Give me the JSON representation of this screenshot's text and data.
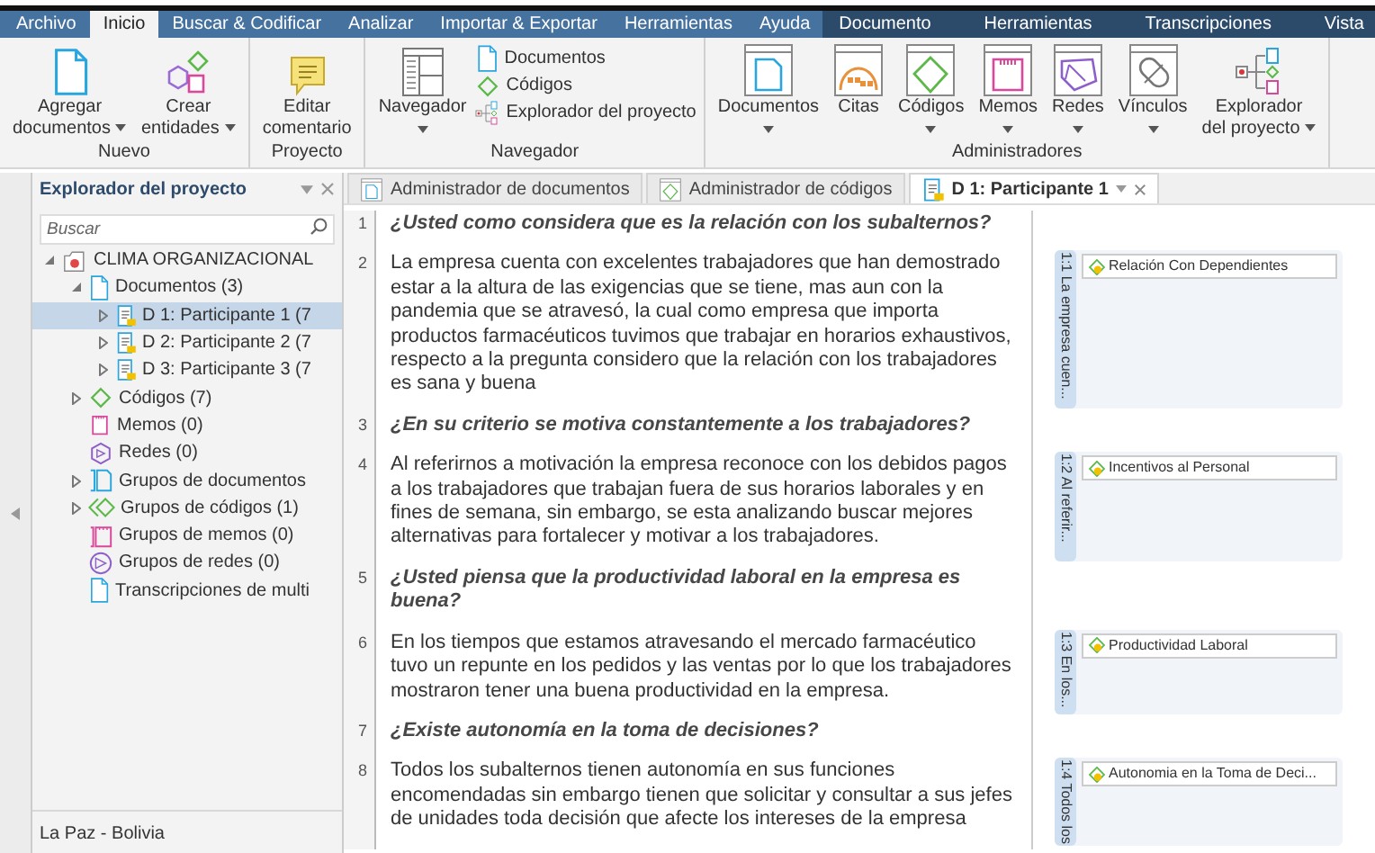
{
  "menu_tabs": [
    {
      "label": "Archivo",
      "selected": false,
      "kind": "main"
    },
    {
      "label": "Inicio",
      "selected": true,
      "kind": "main"
    },
    {
      "label": "Buscar & Codificar",
      "selected": false,
      "kind": "main"
    },
    {
      "label": "Analizar",
      "selected": false,
      "kind": "main"
    },
    {
      "label": "Importar & Exportar",
      "selected": false,
      "kind": "main"
    },
    {
      "label": "Herramientas",
      "selected": false,
      "kind": "main"
    },
    {
      "label": "Ayuda",
      "selected": false,
      "kind": "main"
    },
    {
      "label": "Documento",
      "selected": false,
      "kind": "contextual"
    },
    {
      "label": "Herramientas",
      "selected": false,
      "kind": "contextual"
    },
    {
      "label": "Transcripciones",
      "selected": false,
      "kind": "contextual"
    },
    {
      "label": "Vista",
      "selected": false,
      "kind": "contextual"
    }
  ],
  "ribbon": {
    "groups": [
      {
        "label": "Nuevo",
        "items": [
          {
            "kind": "large",
            "label": "Agregar\ndocumentos",
            "dropdown": true
          },
          {
            "kind": "large",
            "label": "Crear\nentidades",
            "dropdown": true
          }
        ]
      },
      {
        "label": "Proyecto",
        "items": [
          {
            "kind": "large",
            "label": "Editar\ncomentario",
            "dropdown": false
          }
        ]
      },
      {
        "label": "Navegador",
        "items": [
          {
            "kind": "tall",
            "label": "Navegador",
            "dropdown": true
          },
          {
            "kind": "small",
            "label": "Documentos"
          },
          {
            "kind": "small",
            "label": "Códigos"
          },
          {
            "kind": "small",
            "label": "Explorador del proyecto"
          }
        ]
      },
      {
        "label": "Administradores",
        "items": [
          {
            "kind": "tall",
            "label": "Documentos",
            "dropdown": true
          },
          {
            "kind": "tall",
            "label": "Citas",
            "dropdown": false
          },
          {
            "kind": "tall",
            "label": "Códigos",
            "dropdown": true
          },
          {
            "kind": "tall",
            "label": "Memos",
            "dropdown": true
          },
          {
            "kind": "tall",
            "label": "Redes",
            "dropdown": true
          },
          {
            "kind": "tall",
            "label": "Vínculos",
            "dropdown": true
          },
          {
            "kind": "large",
            "label": "Explorador\ndel proyecto",
            "dropdown": true
          }
        ]
      }
    ]
  },
  "explorer": {
    "title": "Explorador del proyecto",
    "search": {
      "placeholder": "Buscar"
    },
    "tree": [
      {
        "label": "CLIMA ORGANIZACIONAL",
        "kind": "project",
        "expanded": true,
        "selected": false,
        "children": [
          {
            "label": "Documentos (3)",
            "kind": "folder",
            "expanded": true,
            "selected": false,
            "children": [
              {
                "label": "D 1: Participante 1 (7",
                "kind": "document",
                "expanded": false,
                "selected": true
              },
              {
                "label": "D 2: Participante 2 (7",
                "kind": "document",
                "expanded": false,
                "selected": false
              },
              {
                "label": "D 3: Participante 3 (7",
                "kind": "document",
                "expanded": false,
                "selected": false
              }
            ]
          },
          {
            "label": "Códigos (7)",
            "kind": "codes",
            "expanded": false,
            "selected": false
          },
          {
            "label": "Memos (0)",
            "kind": "memos",
            "selected": false
          },
          {
            "label": "Redes (0)",
            "kind": "networks",
            "selected": false
          },
          {
            "label": "Grupos de documentos",
            "kind": "docgroups",
            "expanded": false,
            "selected": false
          },
          {
            "label": "Grupos de códigos (1)",
            "kind": "codegroups",
            "expanded": false,
            "selected": false
          },
          {
            "label": "Grupos de memos (0)",
            "kind": "memogroups",
            "selected": false
          },
          {
            "label": "Grupos de redes (0)",
            "kind": "netgroups",
            "selected": false
          },
          {
            "label": "Transcripciones de multi",
            "kind": "transcripts",
            "selected": false
          }
        ]
      }
    ],
    "footer": "La Paz - Bolivia"
  },
  "doc_tabs": [
    {
      "label": "Administrador de documentos",
      "kind": "docmanager",
      "selected": false
    },
    {
      "label": "Administrador de códigos",
      "kind": "codemanager",
      "selected": false
    },
    {
      "label": "D 1: Participante 1",
      "kind": "document",
      "selected": true
    }
  ],
  "paragraphs": [
    {
      "number": "1",
      "kind": "question",
      "text": "¿Usted como considera que es la relación con los subalternos?"
    },
    {
      "number": "2",
      "kind": "answer",
      "text": "La empresa cuenta con excelentes trabajadores que han demostrado estar a la altura de las exigencias que se tiene, mas aun con la pandemia que se atravesó, la cual como empresa que importa productos farmacéuticos tuvimos que trabajar en horarios exhaustivos, respecto a la pregunta considero que la relación con los trabajadores es sana y buena",
      "quotation": {
        "label": "1:1 La empresa cuen...",
        "code": "Relación Con Dependientes"
      }
    },
    {
      "number": "3",
      "kind": "question",
      "text": "¿En su criterio se motiva constantemente a los trabajadores?"
    },
    {
      "number": "4",
      "kind": "answer",
      "text": "Al referirnos a motivación la empresa reconoce con los debidos pagos a los trabajadores que trabajan fuera de sus horarios laborales y en fines de semana, sin embargo, se esta analizando buscar mejores alternativas para fortalecer y motivar a los trabajadores.",
      "quotation": {
        "label": "1:2 Al referir...",
        "code": "Incentivos al Personal"
      }
    },
    {
      "number": "5",
      "kind": "question",
      "text": "¿Usted piensa que la productividad laboral en la empresa es buena?"
    },
    {
      "number": "6",
      "kind": "answer",
      "text": "En los tiempos que estamos atravesando el mercado farmacéutico tuvo un repunte en los pedidos y las ventas por lo que los trabajadores mostraron tener una buena productividad en la empresa.",
      "quotation": {
        "label": "1:3 En los...",
        "code": "Productividad Laboral"
      }
    },
    {
      "number": "7",
      "kind": "question",
      "text": "¿Existe autonomía en la toma de decisiones?"
    },
    {
      "number": "8",
      "kind": "answer",
      "text": "Todos los subalternos tienen autonomía en sus funciones encomendadas sin embargo tienen que solicitar y consultar a sus jefes de unidades toda decisión que afecte los intereses de la empresa",
      "quotation": {
        "label": "1:4 Todos los",
        "code": "Autonomia en la Toma de Deci..."
      }
    }
  ]
}
